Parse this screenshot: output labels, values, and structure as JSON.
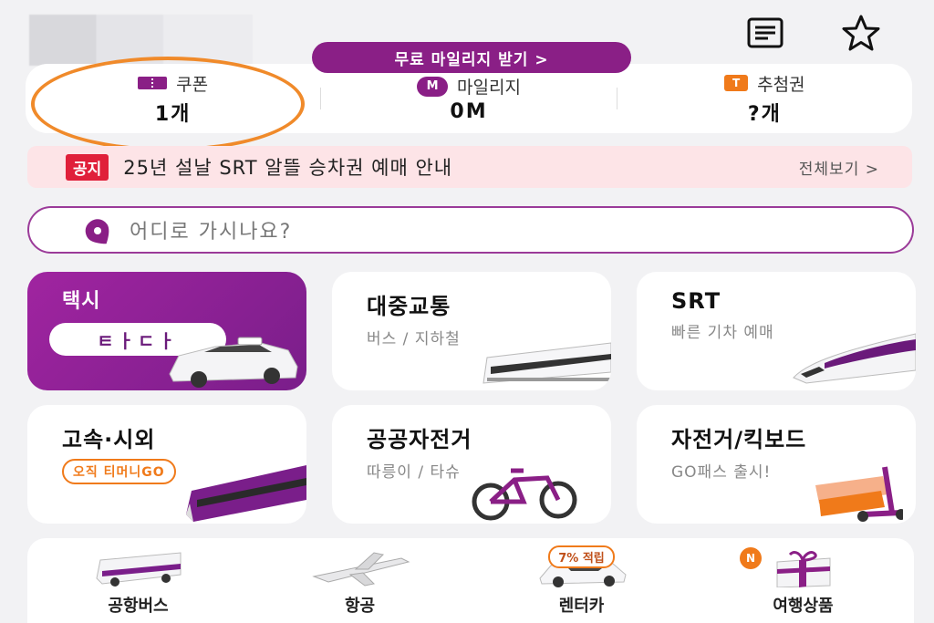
{
  "header": {
    "icons": [
      "document-list-icon",
      "star-icon"
    ]
  },
  "mileage_cta": {
    "label": "무료 마일리지 받기 >"
  },
  "summary": {
    "coupon": {
      "label": "쿠폰",
      "value": "1개"
    },
    "mileage": {
      "label": "마일리지",
      "value": "0M",
      "icon_text": "M"
    },
    "lottery": {
      "label": "추첨권",
      "value": "?개",
      "icon_text": "T"
    }
  },
  "notice": {
    "tag": "공지",
    "text": "25년 설날 SRT 알뜰 승차권 예매 안내",
    "more": "전체보기 >"
  },
  "search": {
    "placeholder": "어디로 가시나요?"
  },
  "services": [
    {
      "title": "택시",
      "sub": "",
      "bubble": "ㅌㅏㄷㅏ"
    },
    {
      "title": "대중교통",
      "sub": "버스 / 지하철"
    },
    {
      "title": "SRT",
      "sub": "빠른 기차 예매"
    },
    {
      "title": "고속·시외",
      "badge": "오직 티머니GO"
    },
    {
      "title": "공공자전거",
      "sub": "따릉이 / 타슈"
    },
    {
      "title": "자전거/킥보드",
      "sub": "GO패스 출시!"
    }
  ],
  "bottom": [
    {
      "label": "공항버스"
    },
    {
      "label": "항공"
    },
    {
      "label": "렌터카",
      "badge": "7% 적립"
    },
    {
      "label": "여행상품",
      "badge": "N"
    }
  ],
  "colors": {
    "brand_purple": "#8a1f86",
    "accent_orange": "#f07a1a",
    "notice_red": "#e0203a",
    "notice_bg": "#fde4e7"
  }
}
